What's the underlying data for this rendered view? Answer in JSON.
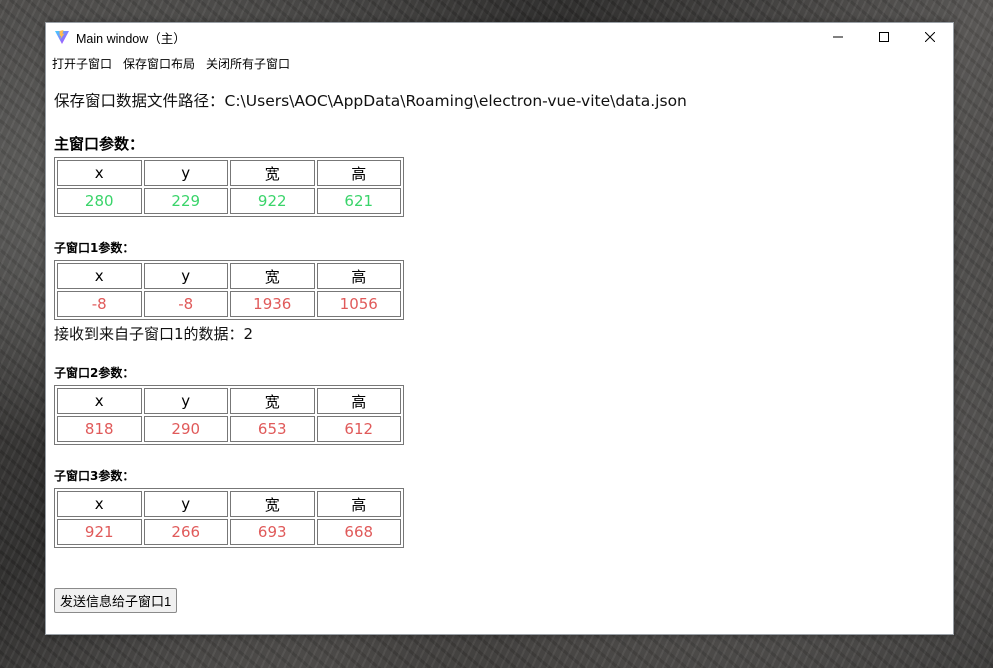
{
  "window": {
    "title": "Main window（主）"
  },
  "menu": {
    "items": [
      "打开子窗口",
      "保存窗口布局",
      "关闭所有子窗口"
    ]
  },
  "content": {
    "path_text": "保存窗口数据文件路径：C:\\Users\\AOC\\AppData\\Roaming\\electron-vue-vite\\data.json",
    "headers": [
      "x",
      "y",
      "宽",
      "高"
    ],
    "main": {
      "title": "主窗口参数：",
      "values": [
        "280",
        "229",
        "922",
        "621"
      ]
    },
    "child1": {
      "title": "子窗口1参数：",
      "values": [
        "-8",
        "-8",
        "1936",
        "1056"
      ],
      "received": "接收到来自子窗口1的数据：2"
    },
    "child2": {
      "title": "子窗口2参数：",
      "values": [
        "818",
        "290",
        "653",
        "612"
      ]
    },
    "child3": {
      "title": "子窗口3参数：",
      "values": [
        "921",
        "266",
        "693",
        "668"
      ]
    },
    "send_button": "发送信息给子窗口1"
  },
  "colors": {
    "main_values": "#3ad46a",
    "child_values": "#e05a5a"
  },
  "icons": {
    "app": "vite-logo-icon",
    "minimize": "minimize-icon",
    "maximize": "maximize-icon",
    "close": "close-icon"
  }
}
